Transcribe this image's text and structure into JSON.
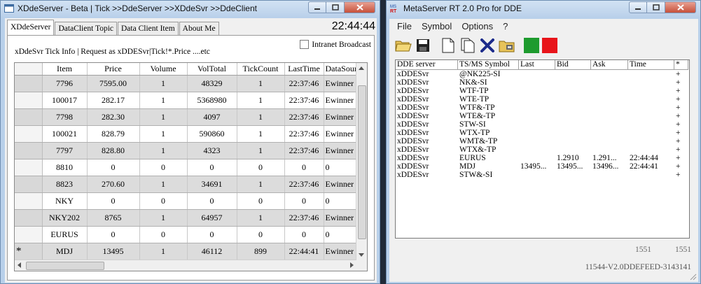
{
  "left_window": {
    "title": "XDdeServer - Beta | Tick >>DdeServer >>XDdeSvr >>DdeClient",
    "tabs": [
      "XDdeServer",
      "DataClient Topic",
      "Data Client Item",
      "About Me"
    ],
    "clock": "22:44:44",
    "group_label": "xDdeSvr Tick Info | Request as xDDESvr|Tick!*.Price ....etc",
    "checkbox_label": "Intranet Broadcast",
    "grid": {
      "columns": [
        "Item",
        "Price",
        "Volume",
        "VolTotal",
        "TickCount",
        "LastTime",
        "DataSource"
      ],
      "rows": [
        {
          "marker": "",
          "cells": [
            "7796",
            "7595.00",
            "1",
            "48329",
            "1",
            "22:37:46",
            "Ewinner"
          ]
        },
        {
          "marker": "",
          "cells": [
            "100017",
            "282.17",
            "1",
            "5368980",
            "1",
            "22:37:46",
            "Ewinner"
          ]
        },
        {
          "marker": "",
          "cells": [
            "7798",
            "282.30",
            "1",
            "4097",
            "1",
            "22:37:46",
            "Ewinner"
          ]
        },
        {
          "marker": "",
          "cells": [
            "100021",
            "828.79",
            "1",
            "590860",
            "1",
            "22:37:46",
            "Ewinner"
          ]
        },
        {
          "marker": "",
          "cells": [
            "7797",
            "828.80",
            "1",
            "4323",
            "1",
            "22:37:46",
            "Ewinner"
          ]
        },
        {
          "marker": "",
          "cells": [
            "8810",
            "0",
            "0",
            "0",
            "0",
            "0",
            "0"
          ]
        },
        {
          "marker": "",
          "cells": [
            "8823",
            "270.60",
            "1",
            "34691",
            "1",
            "22:37:46",
            "Ewinner"
          ]
        },
        {
          "marker": "",
          "cells": [
            "NKY",
            "0",
            "0",
            "0",
            "0",
            "0",
            "0"
          ]
        },
        {
          "marker": "",
          "cells": [
            "NKY202",
            "8765",
            "1",
            "64957",
            "1",
            "22:37:46",
            "Ewinner"
          ]
        },
        {
          "marker": "",
          "cells": [
            "EURUS",
            "0",
            "0",
            "0",
            "0",
            "0",
            "0"
          ]
        },
        {
          "marker": "*",
          "cells": [
            "MDJ",
            "13495",
            "1",
            "46112",
            "899",
            "22:44:41",
            "Ewinner"
          ]
        }
      ]
    }
  },
  "right_window": {
    "title": "MetaServer RT 2.0 Pro for DDE",
    "menu": [
      "File",
      "Symbol",
      "Options",
      "?"
    ],
    "toolbar": [
      {
        "name": "open-folder-icon"
      },
      {
        "name": "save-icon"
      },
      {
        "name": "new-document-icon"
      },
      {
        "name": "copy-document-icon"
      },
      {
        "name": "delete-x-icon"
      },
      {
        "name": "folder-settings-icon"
      },
      {
        "name": "green-start-button",
        "color": "#1e9b2e"
      },
      {
        "name": "red-stop-button",
        "color": "#e8141a"
      }
    ],
    "list": {
      "columns": [
        "DDE server",
        "TS/MS Symbol",
        "Last",
        "Bid",
        "Ask",
        "Time",
        "*"
      ],
      "rows": [
        [
          "xDDESvr",
          "@NK225-SI",
          "",
          "",
          "",
          "",
          "+"
        ],
        [
          "xDDESvr",
          "NK&-SI",
          "",
          "",
          "",
          "",
          "+"
        ],
        [
          "xDDESvr",
          "WTF-TP",
          "",
          "",
          "",
          "",
          "+"
        ],
        [
          "xDDESvr",
          "WTE-TP",
          "",
          "",
          "",
          "",
          "+"
        ],
        [
          "xDDESvr",
          "WTF&-TP",
          "",
          "",
          "",
          "",
          "+"
        ],
        [
          "xDDESvr",
          "WTE&-TP",
          "",
          "",
          "",
          "",
          "+"
        ],
        [
          "xDDESvr",
          "STW-SI",
          "",
          "",
          "",
          "",
          "+"
        ],
        [
          "xDDESvr",
          "WTX-TP",
          "",
          "",
          "",
          "",
          "+"
        ],
        [
          "xDDESvr",
          "WMT&-TP",
          "",
          "",
          "",
          "",
          "+"
        ],
        [
          "xDDESvr",
          "WTX&-TP",
          "",
          "",
          "",
          "",
          "+"
        ],
        [
          "xDDESvr",
          "EURUS",
          "",
          "1.2910",
          "1.291...",
          "22:44:44",
          "+"
        ],
        [
          "xDDESvr",
          "MDJ",
          "13495...",
          "13495...",
          "13496...",
          "22:44:41",
          "+"
        ],
        [
          "xDDESvr",
          "STW&-SI",
          "",
          "",
          "",
          "",
          "+"
        ]
      ]
    },
    "status_counts": [
      "1551",
      "1551"
    ],
    "version": "11544-V2.0DDEFEED-3143141"
  }
}
